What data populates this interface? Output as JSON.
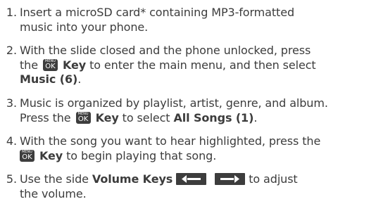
{
  "steps": [
    {
      "number": "1.",
      "lines": [
        "Insert a microSD card* containing MP3-formatted",
        "music into your phone."
      ]
    },
    {
      "number": "2.",
      "line1": "With the slide closed and the phone unlocked, press",
      "line2_pre": "the",
      "line2_bold": "Key",
      "line2_post": "to enter the main menu, and then select",
      "line3_bold": "Music (6)",
      "line3_post": "."
    },
    {
      "number": "3.",
      "line1": "Music is organized by playlist, artist, genre, and album.",
      "line2_pre": "Press the",
      "line2_bold": "Key",
      "line2_mid": "to select",
      "line2_bold2": "All Songs (1)",
      "line2_post": "."
    },
    {
      "number": "4.",
      "line1": "With the song you want to hear highlighted, press the",
      "line2_bold": "Key",
      "line2_post": "to begin playing that song."
    },
    {
      "number": "5.",
      "line1_pre": "Use the side",
      "line1_bold": "Volume Keys",
      "line1_post": "to adjust",
      "line2": "the volume."
    }
  ],
  "key_icon": {
    "top_text": "MENU",
    "main_text": "OK"
  },
  "colors": {
    "text": "#3c3c3c",
    "key_bg": "#3d3d3d"
  }
}
